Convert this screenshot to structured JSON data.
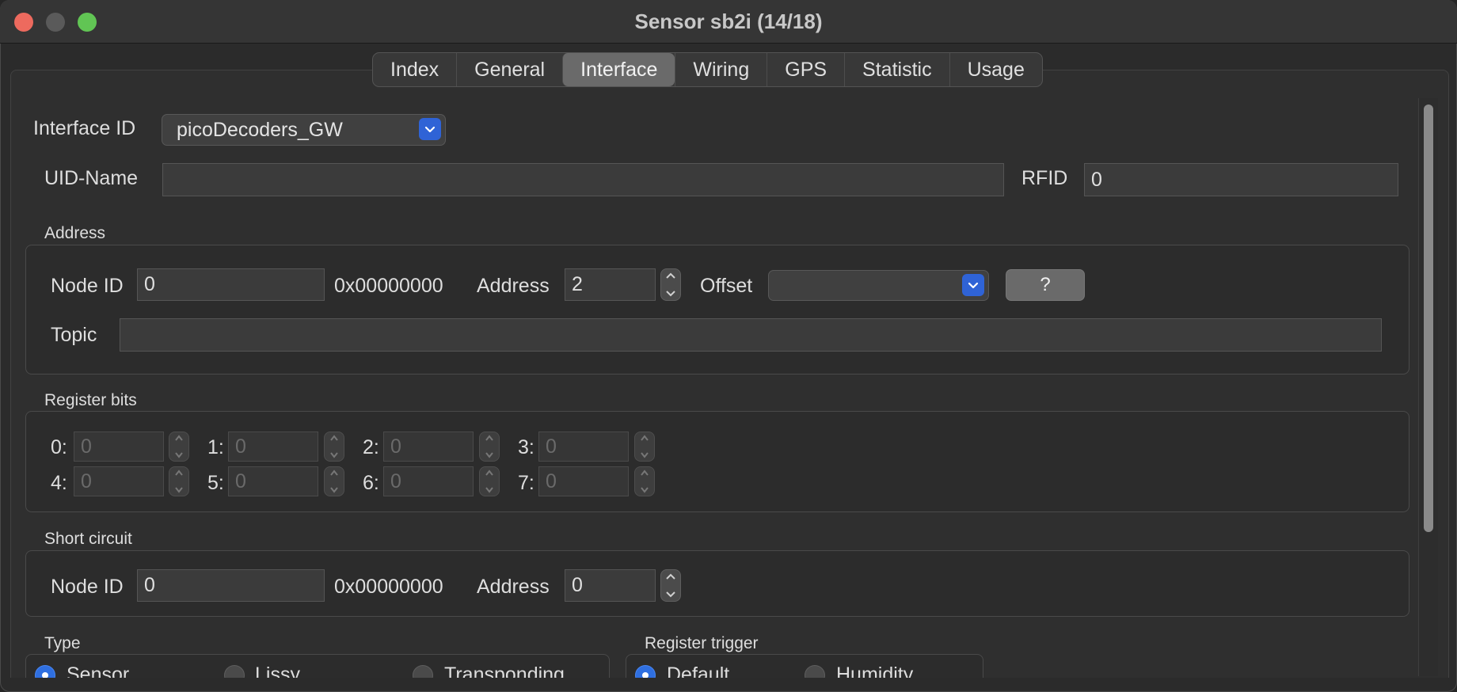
{
  "window": {
    "title": "Sensor sb2i (14/18)"
  },
  "tabs": [
    "Index",
    "General",
    "Interface",
    "Wiring",
    "GPS",
    "Statistic",
    "Usage"
  ],
  "active_tab": "Interface",
  "interface": {
    "interface_id_label": "Interface ID",
    "interface_id_value": "picoDecoders_GW",
    "uid_name_label": "UID-Name",
    "uid_name_value": "",
    "rfid_label": "RFID",
    "rfid_value": "0"
  },
  "address": {
    "section_label": "Address",
    "node_id_label": "Node ID",
    "node_id_value": "0",
    "hex": "0x00000000",
    "address_label": "Address",
    "address_value": "2",
    "offset_label": "Offset",
    "offset_value": "",
    "help_label": "?",
    "topic_label": "Topic",
    "topic_value": ""
  },
  "register_bits": {
    "section_label": "Register bits",
    "bits": [
      {
        "label": "0:",
        "value": "0"
      },
      {
        "label": "1:",
        "value": "0"
      },
      {
        "label": "2:",
        "value": "0"
      },
      {
        "label": "3:",
        "value": "0"
      },
      {
        "label": "4:",
        "value": "0"
      },
      {
        "label": "5:",
        "value": "0"
      },
      {
        "label": "6:",
        "value": "0"
      },
      {
        "label": "7:",
        "value": "0"
      }
    ]
  },
  "short_circuit": {
    "section_label": "Short circuit",
    "node_id_label": "Node ID",
    "node_id_value": "0",
    "hex": "0x00000000",
    "address_label": "Address",
    "address_value": "0"
  },
  "type": {
    "section_label": "Type",
    "options": [
      "Sensor",
      "Lissy",
      "Transponding"
    ],
    "selected": "Sensor"
  },
  "register_trigger": {
    "section_label": "Register trigger",
    "options": [
      "Default",
      "Humidity"
    ],
    "selected": "Default"
  },
  "colors": {
    "accent": "#2f63d6",
    "close": "#ed6a5e",
    "maximize": "#61c554"
  }
}
